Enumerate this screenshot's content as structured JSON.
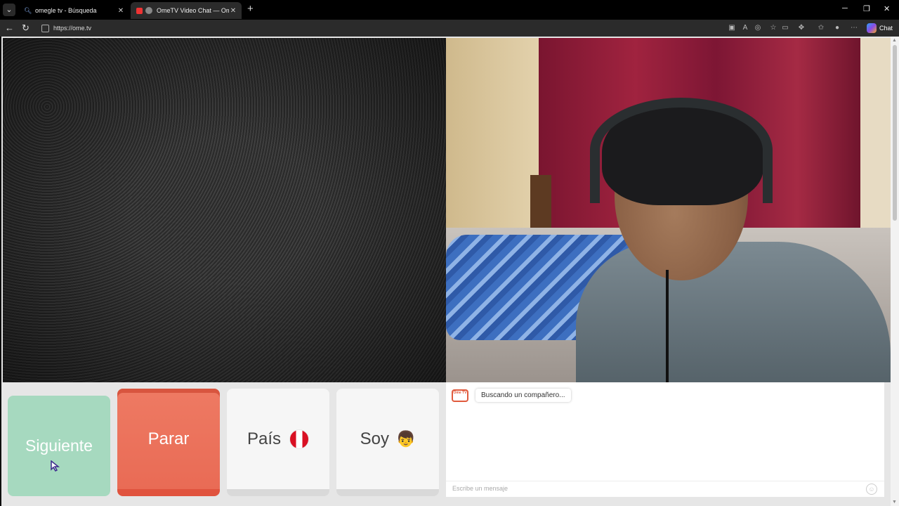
{
  "browser": {
    "tabs": [
      {
        "title": "omegle tv - Búsqueda",
        "active": false
      },
      {
        "title": "OmeTV Video Chat — Omegle",
        "active": true
      }
    ],
    "url": "https://ome.tv",
    "copilot_label": "Chat"
  },
  "controls": {
    "next_label": "Siguiente",
    "stop_label": "Parar",
    "country_label": "País",
    "gender_label": "Soy"
  },
  "chat": {
    "logo_text": "Ome TV",
    "status_message": "Buscando un compañero...",
    "input_placeholder": "Escribe un mensaje"
  },
  "colors": {
    "next_button": "#a6d9bf",
    "stop_button": "#e96b55",
    "country_flag": "Peru"
  },
  "icons": {
    "search": "search-icon",
    "recording": "recording-icon",
    "globe": "globe-icon",
    "refresh": "refresh-icon",
    "back": "back-icon",
    "emoji": "emoji-icon"
  }
}
